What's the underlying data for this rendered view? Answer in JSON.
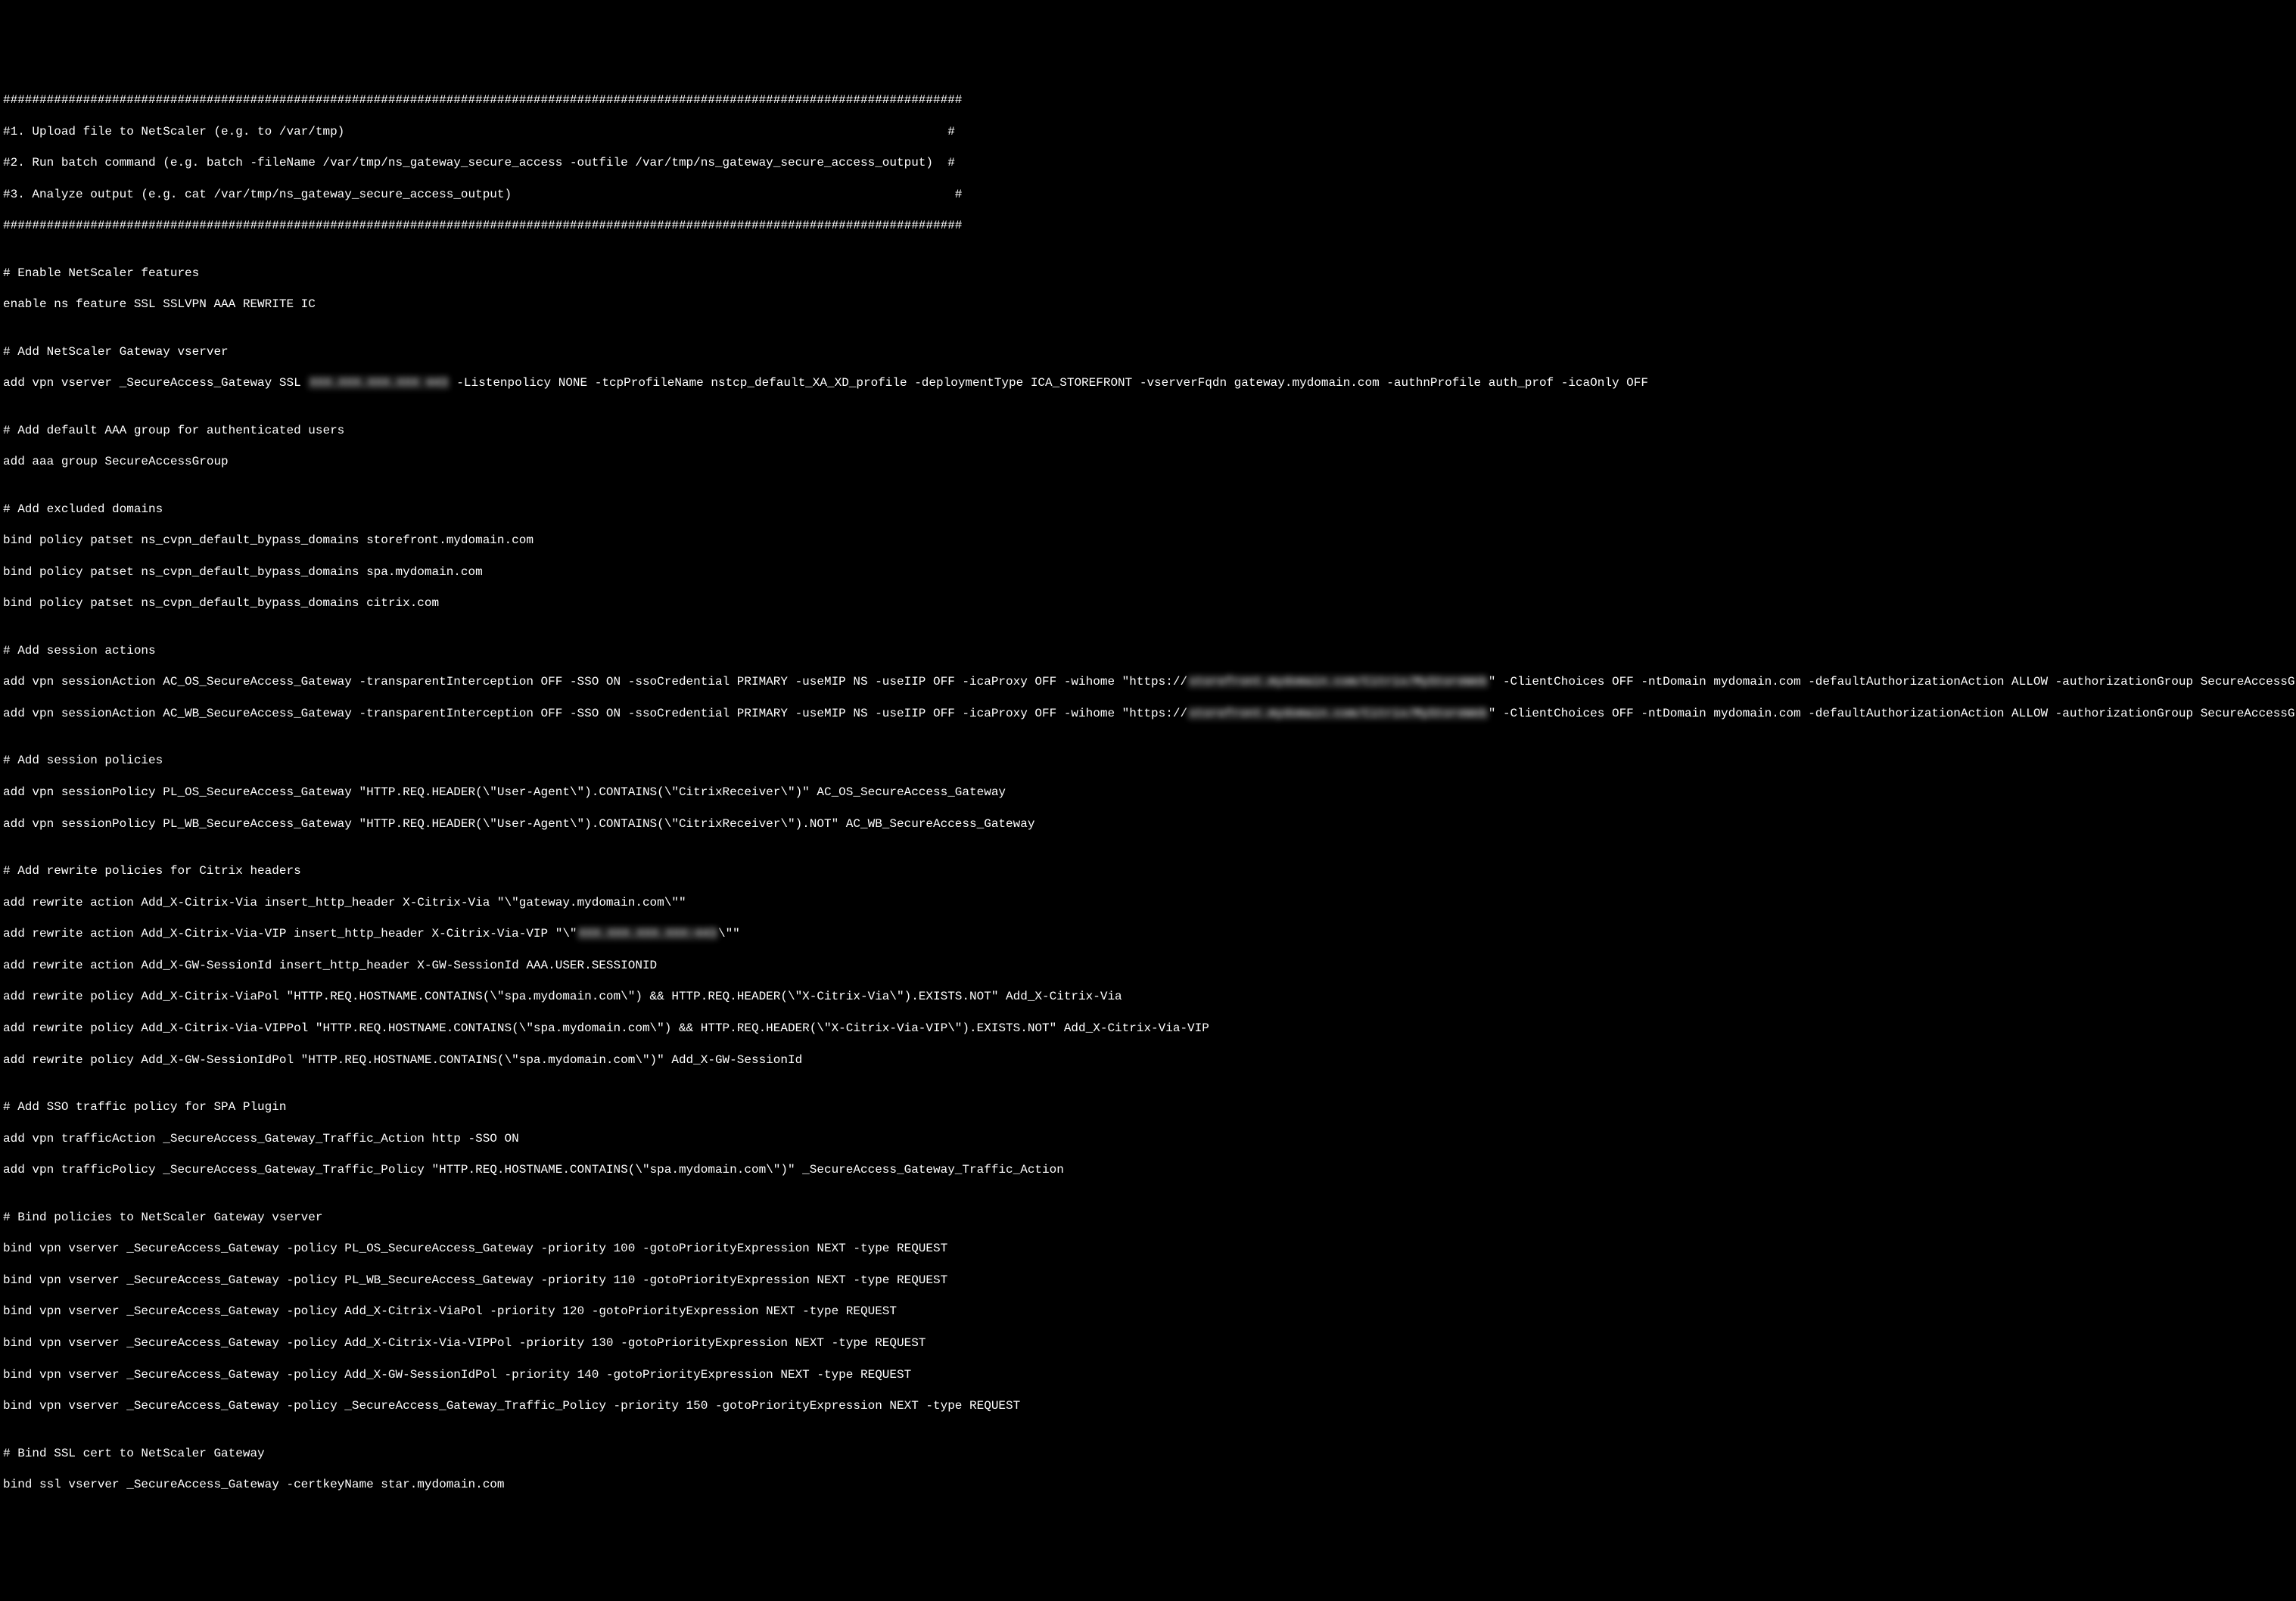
{
  "lines": {
    "l01": "####################################################################################################################################",
    "l02": "#1. Upload file to NetScaler (e.g. to /var/tmp)                                                                                   #",
    "l03": "#2. Run batch command (e.g. batch -fileName /var/tmp/ns_gateway_secure_access -outfile /var/tmp/ns_gateway_secure_access_output)  #",
    "l04": "#3. Analyze output (e.g. cat /var/tmp/ns_gateway_secure_access_output)                                                             #",
    "l05": "####################################################################################################################################",
    "l06": "",
    "l07": "# Enable NetScaler features",
    "l08": "enable ns feature SSL SSLVPN AAA REWRITE IC",
    "l09": "",
    "l10": "# Add NetScaler Gateway vserver",
    "l11a": "add vpn vserver _SecureAccess_Gateway SSL ",
    "l11b": "XXX.XXX.XXX.XXX 443",
    "l11c": " -Listenpolicy NONE -tcpProfileName nstcp_default_XA_XD_profile -deploymentType ICA_STOREFRONT -vserverFqdn gateway.mydomain.com -authnProfile auth_prof -icaOnly OFF",
    "l12": "",
    "l13": "# Add default AAA group for authenticated users",
    "l14": "add aaa group SecureAccessGroup",
    "l15": "",
    "l16": "# Add excluded domains",
    "l17": "bind policy patset ns_cvpn_default_bypass_domains storefront.mydomain.com",
    "l18": "bind policy patset ns_cvpn_default_bypass_domains spa.mydomain.com",
    "l19": "bind policy patset ns_cvpn_default_bypass_domains citrix.com",
    "l20": "",
    "l21": "# Add session actions",
    "l22a": "add vpn sessionAction AC_OS_SecureAccess_Gateway -transparentInterception OFF -SSO ON -ssoCredential PRIMARY -useMIP NS -useIIP OFF -icaProxy OFF -wihome \"https://",
    "l22b": "storefront.mydomain.com/Citrix/MyStoreWeb",
    "l22c": "\" -ClientChoices OFF -ntDomain mydomain.com -defaultAuthorizationAction ALLOW -authorizationGroup SecureAccessGroup -clientlessVpnMode ON -clientlessModeUrlEncoding TRANSPARENT -SecureBrowse ENABLED -storefronturl \"https://storefront.mydomain.com\" -sfGatewayAuthType domain",
    "l23a": "add vpn sessionAction AC_WB_SecureAccess_Gateway -transparentInterception OFF -SSO ON -ssoCredential PRIMARY -useMIP NS -useIIP OFF -icaProxy OFF -wihome \"https://",
    "l23b": "storefront.mydomain.com/Citrix/MyStoreWeb",
    "l23c": "\" -ClientChoices OFF -ntDomain mydomain.com -defaultAuthorizationAction ALLOW -authorizationGroup SecureAccessGroup -clientlessVpnMode ON -clientlessModeUrlEncoding TRANSPARENT -SecureBrowse ENABLED -storefronturl \"https://storefront.mydomain.com\" -sfGatewayAuthType domain",
    "l24": "",
    "l25": "# Add session policies",
    "l26": "add vpn sessionPolicy PL_OS_SecureAccess_Gateway \"HTTP.REQ.HEADER(\\\"User-Agent\\\").CONTAINS(\\\"CitrixReceiver\\\")\" AC_OS_SecureAccess_Gateway",
    "l27": "add vpn sessionPolicy PL_WB_SecureAccess_Gateway \"HTTP.REQ.HEADER(\\\"User-Agent\\\").CONTAINS(\\\"CitrixReceiver\\\").NOT\" AC_WB_SecureAccess_Gateway",
    "l28": "",
    "l29": "# Add rewrite policies for Citrix headers",
    "l30": "add rewrite action Add_X-Citrix-Via insert_http_header X-Citrix-Via \"\\\"gateway.mydomain.com\\\"\"",
    "l31a": "add rewrite action Add_X-Citrix-Via-VIP insert_http_header X-Citrix-Via-VIP \"\\\"",
    "l31b": "XXX.XXX.XXX.XXX:443",
    "l31c": "\\\"\"",
    "l32": "add rewrite action Add_X-GW-SessionId insert_http_header X-GW-SessionId AAA.USER.SESSIONID",
    "l33": "add rewrite policy Add_X-Citrix-ViaPol \"HTTP.REQ.HOSTNAME.CONTAINS(\\\"spa.mydomain.com\\\") && HTTP.REQ.HEADER(\\\"X-Citrix-Via\\\").EXISTS.NOT\" Add_X-Citrix-Via",
    "l34": "add rewrite policy Add_X-Citrix-Via-VIPPol \"HTTP.REQ.HOSTNAME.CONTAINS(\\\"spa.mydomain.com\\\") && HTTP.REQ.HEADER(\\\"X-Citrix-Via-VIP\\\").EXISTS.NOT\" Add_X-Citrix-Via-VIP",
    "l35": "add rewrite policy Add_X-GW-SessionIdPol \"HTTP.REQ.HOSTNAME.CONTAINS(\\\"spa.mydomain.com\\\")\" Add_X-GW-SessionId",
    "l36": "",
    "l37": "# Add SSO traffic policy for SPA Plugin",
    "l38": "add vpn trafficAction _SecureAccess_Gateway_Traffic_Action http -SSO ON",
    "l39": "add vpn trafficPolicy _SecureAccess_Gateway_Traffic_Policy \"HTTP.REQ.HOSTNAME.CONTAINS(\\\"spa.mydomain.com\\\")\" _SecureAccess_Gateway_Traffic_Action",
    "l40": "",
    "l41": "# Bind policies to NetScaler Gateway vserver",
    "l42": "bind vpn vserver _SecureAccess_Gateway -policy PL_OS_SecureAccess_Gateway -priority 100 -gotoPriorityExpression NEXT -type REQUEST",
    "l43": "bind vpn vserver _SecureAccess_Gateway -policy PL_WB_SecureAccess_Gateway -priority 110 -gotoPriorityExpression NEXT -type REQUEST",
    "l44": "bind vpn vserver _SecureAccess_Gateway -policy Add_X-Citrix-ViaPol -priority 120 -gotoPriorityExpression NEXT -type REQUEST",
    "l45": "bind vpn vserver _SecureAccess_Gateway -policy Add_X-Citrix-Via-VIPPol -priority 130 -gotoPriorityExpression NEXT -type REQUEST",
    "l46": "bind vpn vserver _SecureAccess_Gateway -policy Add_X-GW-SessionIdPol -priority 140 -gotoPriorityExpression NEXT -type REQUEST",
    "l47": "bind vpn vserver _SecureAccess_Gateway -policy _SecureAccess_Gateway_Traffic_Policy -priority 150 -gotoPriorityExpression NEXT -type REQUEST",
    "l48": "",
    "l49": "# Bind SSL cert to NetScaler Gateway",
    "l50": "bind ssl vserver _SecureAccess_Gateway -certkeyName star.mydomain.com"
  }
}
